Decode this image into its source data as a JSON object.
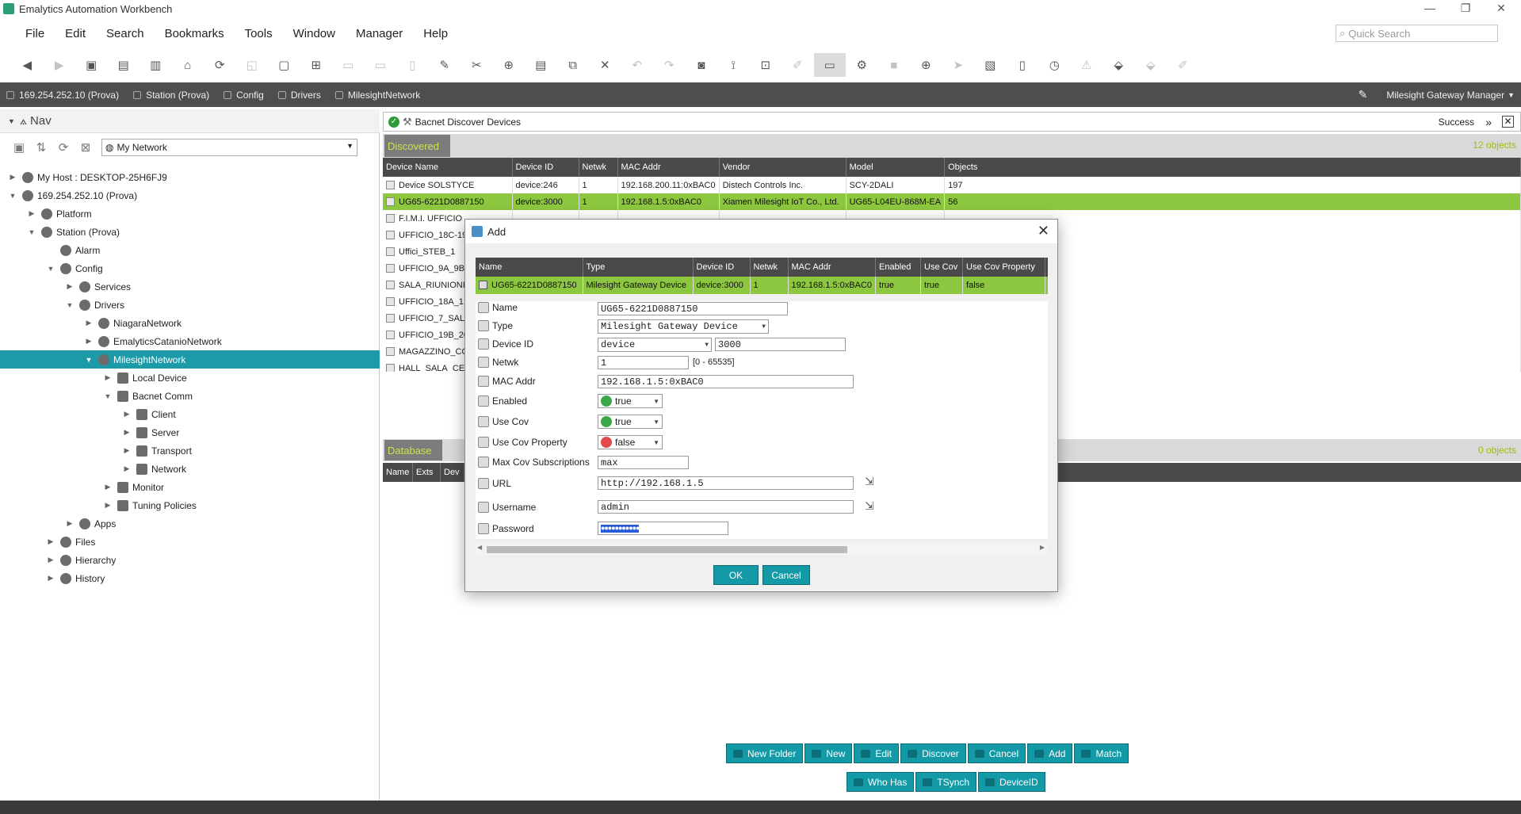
{
  "window": {
    "title": "Emalytics Automation Workbench"
  },
  "menu": [
    "File",
    "Edit",
    "Search",
    "Bookmarks",
    "Tools",
    "Window",
    "Manager",
    "Help"
  ],
  "quick_search": {
    "placeholder": "Quick Search"
  },
  "breadcrumbs": [
    "169.254.252.10 (Prova)",
    "Station (Prova)",
    "Config",
    "Drivers",
    "MilesightNetwork"
  ],
  "view_selector": "Milesight Gateway Manager",
  "nav": {
    "title": "Nav",
    "network_select": "My Network",
    "tree": [
      {
        "label": "My Host : DESKTOP-25H6FJ9",
        "level": 0,
        "expand": "▶"
      },
      {
        "label": "169.254.252.10 (Prova)",
        "level": 0,
        "expand": "▼"
      },
      {
        "label": "Platform",
        "level": 1,
        "expand": "▶"
      },
      {
        "label": "Station (Prova)",
        "level": 1,
        "expand": "▼"
      },
      {
        "label": "Alarm",
        "level": 2,
        "expand": ""
      },
      {
        "label": "Config",
        "level": 2,
        "expand": "▼"
      },
      {
        "label": "Services",
        "level": 3,
        "expand": "▶"
      },
      {
        "label": "Drivers",
        "level": 3,
        "expand": "▼"
      },
      {
        "label": "NiagaraNetwork",
        "level": 4,
        "expand": "▶"
      },
      {
        "label": "EmalyticsCatanioNetwork",
        "level": 4,
        "expand": "▶"
      },
      {
        "label": "MilesightNetwork",
        "level": 4,
        "expand": "▼",
        "selected": true
      },
      {
        "label": "Local Device",
        "level": 5,
        "expand": "▶"
      },
      {
        "label": "Bacnet Comm",
        "level": 5,
        "expand": "▼"
      },
      {
        "label": "Client",
        "level": 6,
        "expand": "▶"
      },
      {
        "label": "Server",
        "level": 6,
        "expand": "▶"
      },
      {
        "label": "Transport",
        "level": 6,
        "expand": "▶"
      },
      {
        "label": "Network",
        "level": 6,
        "expand": "▶"
      },
      {
        "label": "Monitor",
        "level": 5,
        "expand": "▶"
      },
      {
        "label": "Tuning Policies",
        "level": 5,
        "expand": "▶"
      },
      {
        "label": "Apps",
        "level": 3,
        "expand": "▶"
      },
      {
        "label": "Files",
        "level": 2,
        "expand": "▶"
      },
      {
        "label": "Hierarchy",
        "level": 2,
        "expand": "▶"
      },
      {
        "label": "History",
        "level": 2,
        "expand": "▶"
      }
    ]
  },
  "discover_job": {
    "title": "Bacnet Discover Devices",
    "status": "Success"
  },
  "discovered": {
    "tab": "Discovered",
    "count": "12 objects",
    "columns": [
      "Device Name",
      "Device ID",
      "Netwk",
      "MAC Addr",
      "Vendor",
      "Model",
      "Objects"
    ],
    "rows": [
      [
        "Device SOLSTYCE",
        "device:246",
        "1",
        "192.168.200.11:0xBAC0",
        "Distech Controls Inc.",
        "SCY-2DALI",
        "197"
      ],
      [
        "UG65-6221D0887150",
        "device:3000",
        "1",
        "192.168.1.5:0xBAC0",
        "Xiamen Milesight IoT Co., Ltd.",
        "UG65-L04EU-868M-EA",
        "56"
      ],
      [
        "F.I.M.I. UFFICIO",
        "",
        "",
        "",
        "",
        "",
        ""
      ],
      [
        "UFFICIO_18C-19",
        "",
        "",
        "",
        "",
        "",
        ""
      ],
      [
        "Uffici_STEB_1",
        "",
        "",
        "",
        "",
        "",
        ""
      ],
      [
        "UFFICIO_9A_9B",
        "",
        "",
        "",
        "",
        "",
        ""
      ],
      [
        "SALA_RIUNIONI",
        "",
        "",
        "",
        "",
        "",
        ""
      ],
      [
        "UFFICIO_18A_1",
        "",
        "",
        "",
        "",
        "",
        ""
      ],
      [
        "UFFICIO_7_SALA",
        "",
        "",
        "",
        "",
        "",
        ""
      ],
      [
        "UFFICIO_19B_20",
        "",
        "",
        "",
        "",
        "",
        ""
      ],
      [
        "MAGAZZINO_CO",
        "",
        "",
        "",
        "",
        "",
        ""
      ],
      [
        "HALL_SALA_CE",
        "",
        "",
        "",
        "",
        "",
        ""
      ]
    ],
    "selected_row": 1
  },
  "database": {
    "tab": "Database",
    "count": "0 objects",
    "columns": [
      "Name",
      "Exts",
      "Dev"
    ]
  },
  "buttons_row1": [
    "New Folder",
    "New",
    "Edit",
    "Discover",
    "Cancel",
    "Add",
    "Match"
  ],
  "buttons_row2": [
    "Who Has",
    "TSynch",
    "DeviceID"
  ],
  "dialog": {
    "title": "Add",
    "columns": [
      "Name",
      "Type",
      "Device ID",
      "Netwk",
      "MAC Addr",
      "Enabled",
      "Use Cov",
      "Use Cov Property"
    ],
    "row": [
      "UG65-6221D0887150",
      "Milesight Gateway Device",
      "device:3000",
      "1",
      "192.168.1.5:0xBAC0",
      "true",
      "true",
      "false"
    ],
    "fields": {
      "name_label": "Name",
      "name": "UG65-6221D0887150",
      "type_label": "Type",
      "type": "Milesight Gateway Device",
      "devid_label": "Device ID",
      "devid_kind": "device",
      "devid_num": "3000",
      "netwk_label": "Netwk",
      "netwk": "1",
      "netwk_range": "[0 - 65535]",
      "mac_label": "MAC Addr",
      "mac": "192.168.1.5:0xBAC0",
      "enabled_label": "Enabled",
      "enabled": "true",
      "usecov_label": "Use Cov",
      "usecov": "true",
      "usecovprop_label": "Use Cov Property",
      "usecovprop": "false",
      "maxcov_label": "Max Cov Subscriptions",
      "maxcov": "max",
      "url_label": "URL",
      "url": "http://192.168.1.5",
      "user_label": "Username",
      "user": "admin",
      "pass_label": "Password",
      "pass": "●●●●●●●●●●●"
    },
    "ok": "OK",
    "cancel": "Cancel"
  },
  "colors": {
    "accent": "#139aa6",
    "selected_row": "#8dc63f",
    "tab_text": "#c8e34a",
    "header_bg": "#4a4a4a"
  }
}
